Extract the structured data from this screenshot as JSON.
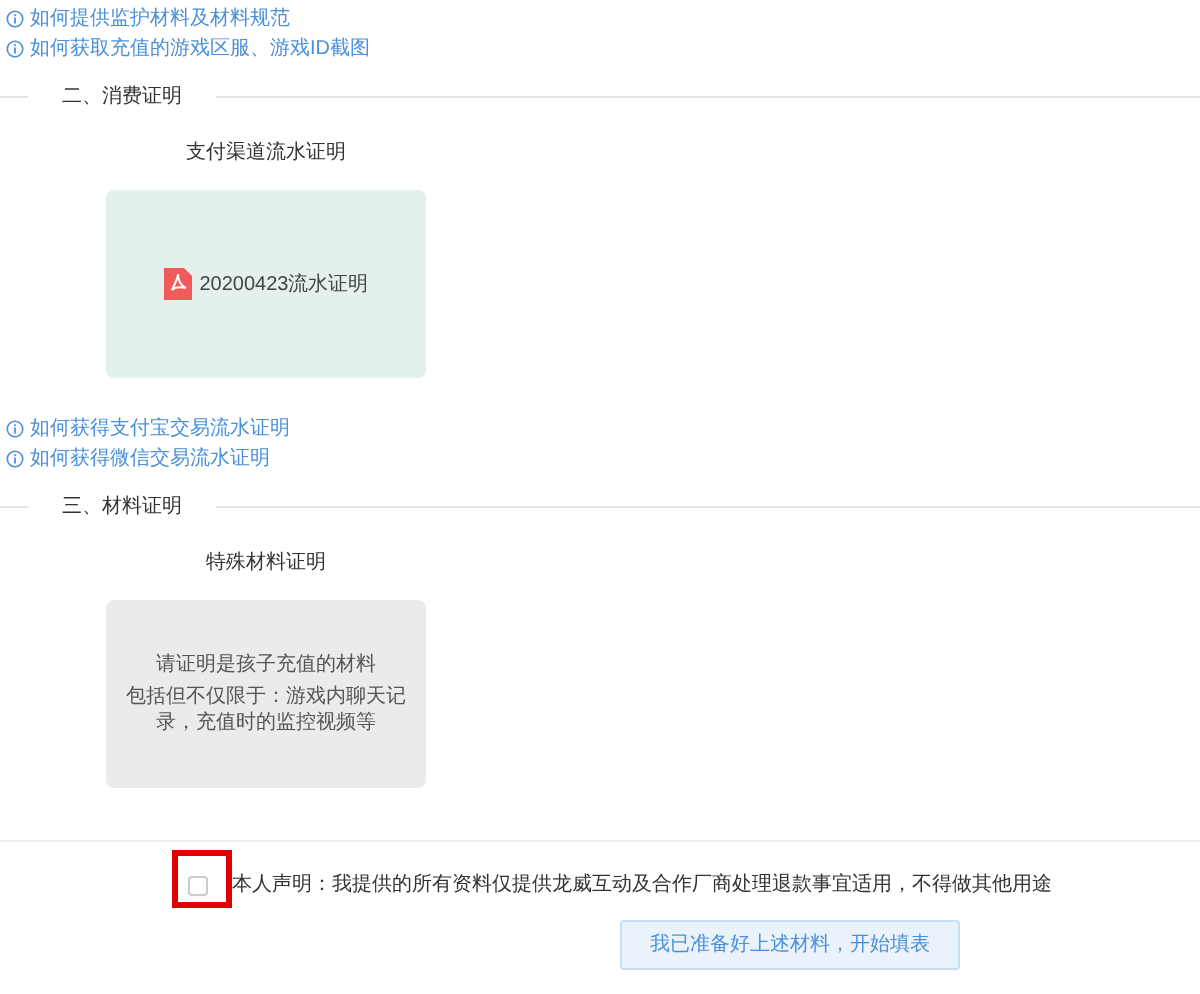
{
  "sections": [
    {
      "kind": "links",
      "links": [
        "如何提供监护材料及材料规范",
        "如何获取充值的游戏区服、游戏ID截图"
      ]
    },
    {
      "kind": "header",
      "title": "二、消费证明"
    },
    {
      "kind": "file_card",
      "label": "支付渠道流水证明",
      "file": "20200423流水证明"
    },
    {
      "kind": "links",
      "links": [
        "如何获得支付宝交易流水证明",
        "如何获得微信交易流水证明"
      ]
    },
    {
      "kind": "header",
      "title": "三、材料证明"
    },
    {
      "kind": "hint_card",
      "label": "特殊材料证明",
      "lines": [
        "请证明是孩子充值的材料",
        "包括但不仅限于：游戏内聊天记录，充值时的监控视频等"
      ]
    }
  ],
  "declaration": {
    "checked": false,
    "highlighted": true,
    "text": "本人声明：我提供的所有资料仅提供龙威互动及合作厂商处理退款事宜适用，不得做其他用途"
  },
  "submit_button": "我已准备好上述材料，开始填表"
}
